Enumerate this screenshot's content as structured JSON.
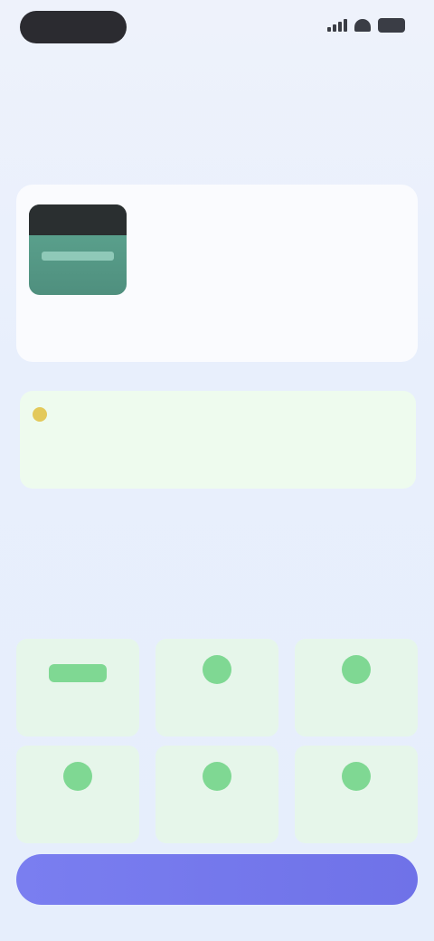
{
  "status_bar": {
    "pill_text": "",
    "icons": [
      "signal-icon",
      "wifi-icon",
      "battery-icon"
    ]
  },
  "header": {
    "caption": ""
  },
  "hero": {
    "headline": "",
    "tagline": ""
  },
  "product": {
    "image_icon": "product-jar-image",
    "title": "",
    "subtitle": "",
    "meta_left": "",
    "meta_mid": "",
    "meta_right": ""
  },
  "promo": {
    "title_prefix": "",
    "title_highlight": "",
    "title_suffix": "",
    "text": ""
  },
  "features_section": {
    "title": "",
    "subtitle": "",
    "items": [
      {
        "icon": "feature-icon",
        "label": ""
      },
      {
        "icon": "feature-icon",
        "label": ""
      },
      {
        "icon": "feature-icon",
        "label": ""
      },
      {
        "icon": "feature-icon",
        "label": ""
      },
      {
        "icon": "feature-icon",
        "label": ""
      },
      {
        "icon": "feature-icon",
        "label": ""
      }
    ]
  },
  "cta": {
    "label": ""
  },
  "colors": {
    "accent": "#6f72e8",
    "promo_bg": "#eefbee",
    "feature_bg": "#e6f6ea",
    "feature_icon": "#7fd893"
  }
}
